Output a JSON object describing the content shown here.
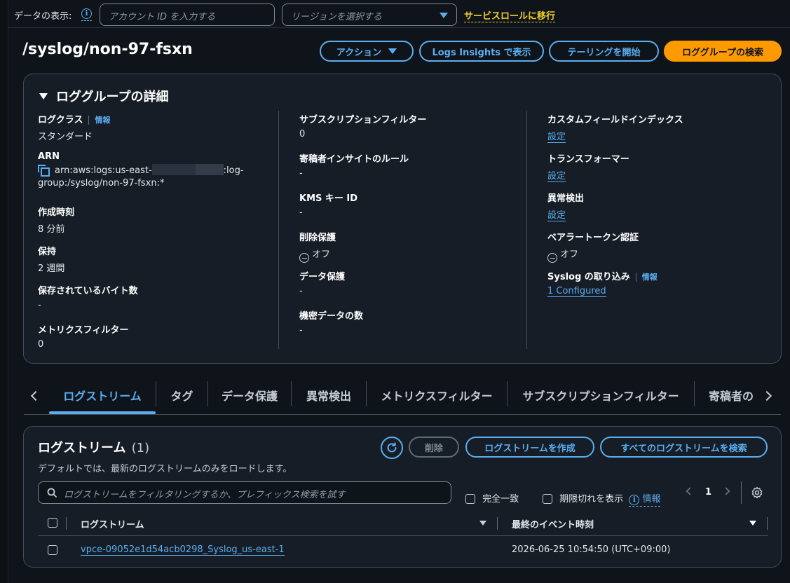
{
  "topbar": {
    "display_label": "データの表示:",
    "account_placeholder": "アカウント ID を入力する",
    "region_placeholder": "リージョンを選択する",
    "service_role_link": "サービスロールに移行"
  },
  "header": {
    "title": "/syslog/non-97-fsxn",
    "actions_label": "アクション",
    "logs_insights_label": "Logs Insights で表示",
    "tail_label": "テーリングを開始",
    "search_group_label": "ロググループの検索"
  },
  "details": {
    "title": "ロググループの詳細",
    "col1": {
      "log_class_key": "ログクラス",
      "info_label": "情報",
      "log_class_value": "スタンダード",
      "arn_key": "ARN",
      "arn_part1": "arn:aws:logs:us-east-",
      "arn_part2": ":log-",
      "arn_line2": "group:/syslog/non-97-fsxn:*",
      "created_key": "作成時刻",
      "created_value": "8 分前",
      "retention_key": "保持",
      "retention_value": "2 週間",
      "stored_bytes_key": "保存されているバイト数",
      "stored_bytes_value": "-",
      "metric_filters_key": "メトリクスフィルター",
      "metric_filters_value": "0"
    },
    "col2": {
      "subscription_key": "サブスクリプションフィルター",
      "subscription_value": "0",
      "contributor_key": "寄稿者インサイトのルール",
      "contributor_value": "-",
      "kms_key": "KMS キー ID",
      "kms_value": "-",
      "deletion_key": "削除保護",
      "deletion_value": "オフ",
      "data_protection_key": "データ保護",
      "data_protection_value": "-",
      "sensitive_key": "機密データの数",
      "sensitive_value": "-"
    },
    "col3": {
      "custom_index_key": "カスタムフィールドインデックス",
      "custom_index_value": "設定",
      "transformer_key": "トランスフォーマー",
      "transformer_value": "設定",
      "anomaly_key": "異常検出",
      "anomaly_value": "設定",
      "bearer_key": "ベアラートークン認証",
      "bearer_value": "オフ",
      "syslog_key": "Syslog の取り込み",
      "info_label": "情報",
      "syslog_value": "1 Configured"
    }
  },
  "tabs": [
    {
      "label": "ログストリーム"
    },
    {
      "label": "タグ"
    },
    {
      "label": "データ保護"
    },
    {
      "label": "異常検出"
    },
    {
      "label": "メトリクスフィルター"
    },
    {
      "label": "サブスクリプションフィルター"
    },
    {
      "label": "寄稿者の"
    }
  ],
  "streams": {
    "title": "ログストリーム",
    "count": "(1)",
    "description": "デフォルトでは、最新のログストリームのみをロードします。",
    "delete_label": "削除",
    "create_label": "ログストリームを作成",
    "search_all_label": "すべてのログストリームを検索",
    "filter_placeholder": "ログストリームをフィルタリングするか、プレフィックス検索を試す",
    "exact_match_label": "完全一致",
    "show_expired_label": "期限切れを表示",
    "info_label": "情報",
    "page_number": "1",
    "col_stream": "ログストリーム",
    "col_last_event": "最終のイベント時刻",
    "rows": [
      {
        "name": "vpce-09052e1d54acb0298_Syslog_us-east-1",
        "last_event": "2026-06-25 10:54:50 (UTC+09:00)"
      }
    ]
  }
}
